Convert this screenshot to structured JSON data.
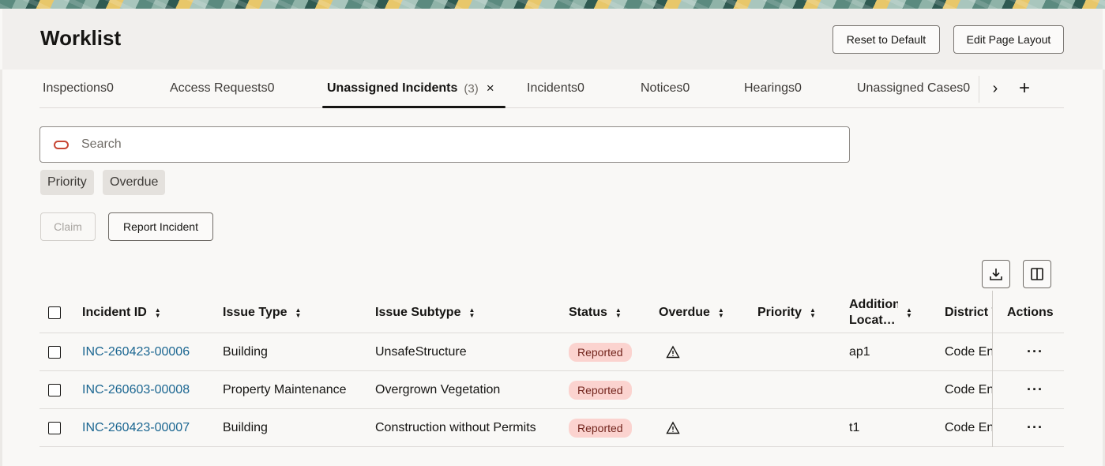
{
  "header": {
    "title": "Worklist",
    "reset_label": "Reset to Default",
    "edit_layout_label": "Edit Page Layout"
  },
  "tabs": [
    {
      "label": "Inspections0"
    },
    {
      "label": "Access Requests0"
    },
    {
      "label": "Unassigned Incidents",
      "count": "(3)",
      "close": "×"
    },
    {
      "label": "Incidents0"
    },
    {
      "label": "Notices0"
    },
    {
      "label": "Hearings0"
    },
    {
      "label": "Unassigned Cases0"
    }
  ],
  "tab_actions": {
    "next": "›",
    "add": "+"
  },
  "search": {
    "placeholder": "Search"
  },
  "filters": [
    "Priority",
    "Overdue"
  ],
  "actions": {
    "claim_label": "Claim",
    "report_label": "Report Incident"
  },
  "table": {
    "columns": [
      "Incident ID",
      "Issue Type",
      "Issue Subtype",
      "Status",
      "Overdue",
      "Priority",
      "Addition",
      "Locat…",
      "District T",
      "Actions"
    ],
    "rows": [
      {
        "id": "INC-260423-00006",
        "issue_type": "Building",
        "issue_subtype": "UnsafeStructure",
        "status": "Reported",
        "overdue": true,
        "priority": "",
        "location": "ap1",
        "district": "Code Enforcement",
        "actions": "···"
      },
      {
        "id": "INC-260603-00008",
        "issue_type": "Property Maintenance",
        "issue_subtype": "Overgrown Vegetation",
        "status": "Reported",
        "overdue": false,
        "priority": "",
        "location": "",
        "district": "Code Enforcement",
        "actions": "···"
      },
      {
        "id": "INC-260423-00007",
        "issue_type": "Building",
        "issue_subtype": "Construction without Permits",
        "status": "Reported",
        "overdue": true,
        "priority": "",
        "location": "t1",
        "district": "Code Enforcement",
        "actions": "···"
      }
    ]
  },
  "icons": {
    "search": "oracle-search-icon",
    "download": "download-icon",
    "columns": "column-manager-icon",
    "overdue": "warning-triangle-icon",
    "sort": "sort-arrows-icon"
  },
  "colors": {
    "link": "#1b6691",
    "badge_bg": "#fbd3cf",
    "badge_text": "#72241c",
    "search_icon": "#c74634"
  }
}
